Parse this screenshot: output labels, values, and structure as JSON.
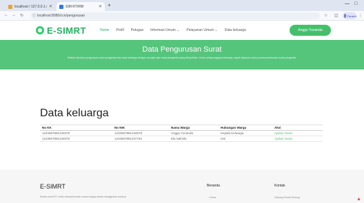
{
  "browser": {
    "tabs": [
      {
        "title": "localhost / 127.0.0.1 / db_surat",
        "active": false
      },
      {
        "title": "SIM RT/RW",
        "active": true
      }
    ],
    "url": "localhost:8080/ccn/pengurusan",
    "profile_label": "Paused"
  },
  "nav": {
    "brand": "E-SIMRT",
    "items": [
      "Home",
      "Profil",
      "Petugas",
      "Informasi Umum ⌄",
      "Pelayanan Umum ⌄",
      "Data keluarga"
    ],
    "active_item": "Home",
    "cta_label": "Anggo Yunanda"
  },
  "hero": {
    "title": "Data Pengurusan Surat",
    "subtitle": "Silakan lakukan pengurusan surat pengantar dan data keluarga dengan mengisi atau surat pengantar yang dibutuhkan. Untuk setiap anggota keluarga, dapat diajukan untuk proses pembuatan surat pengantar."
  },
  "section": {
    "title": "Data keluarga"
  },
  "table": {
    "headers": [
      "No KK",
      "No NIK",
      "Nama Warga",
      "Hubungan Warga",
      "Aksi"
    ],
    "rows": [
      [
        "1234567891234678",
        "1234567891234678",
        "Anggo Yunanda",
        "Kepala Keluarga",
        "Ajukan Surat"
      ],
      [
        "1234567891234678",
        "1234567891237794",
        "Ela Salmila",
        "Istri",
        "Ajukan Surat"
      ]
    ]
  },
  "footer": {
    "brand": "E-SIMRT",
    "description": "Sistem surat RT untuk mempermudah urusan warga dalam mengajukan surat pengantar",
    "col1_title": "Beranda",
    "col1_item": "› Home",
    "col2_title": "Kontak",
    "col2_item": "Gedung Paroki Gedung"
  },
  "colors": {
    "accent": "#56c57c",
    "brand": "#27ae60"
  }
}
